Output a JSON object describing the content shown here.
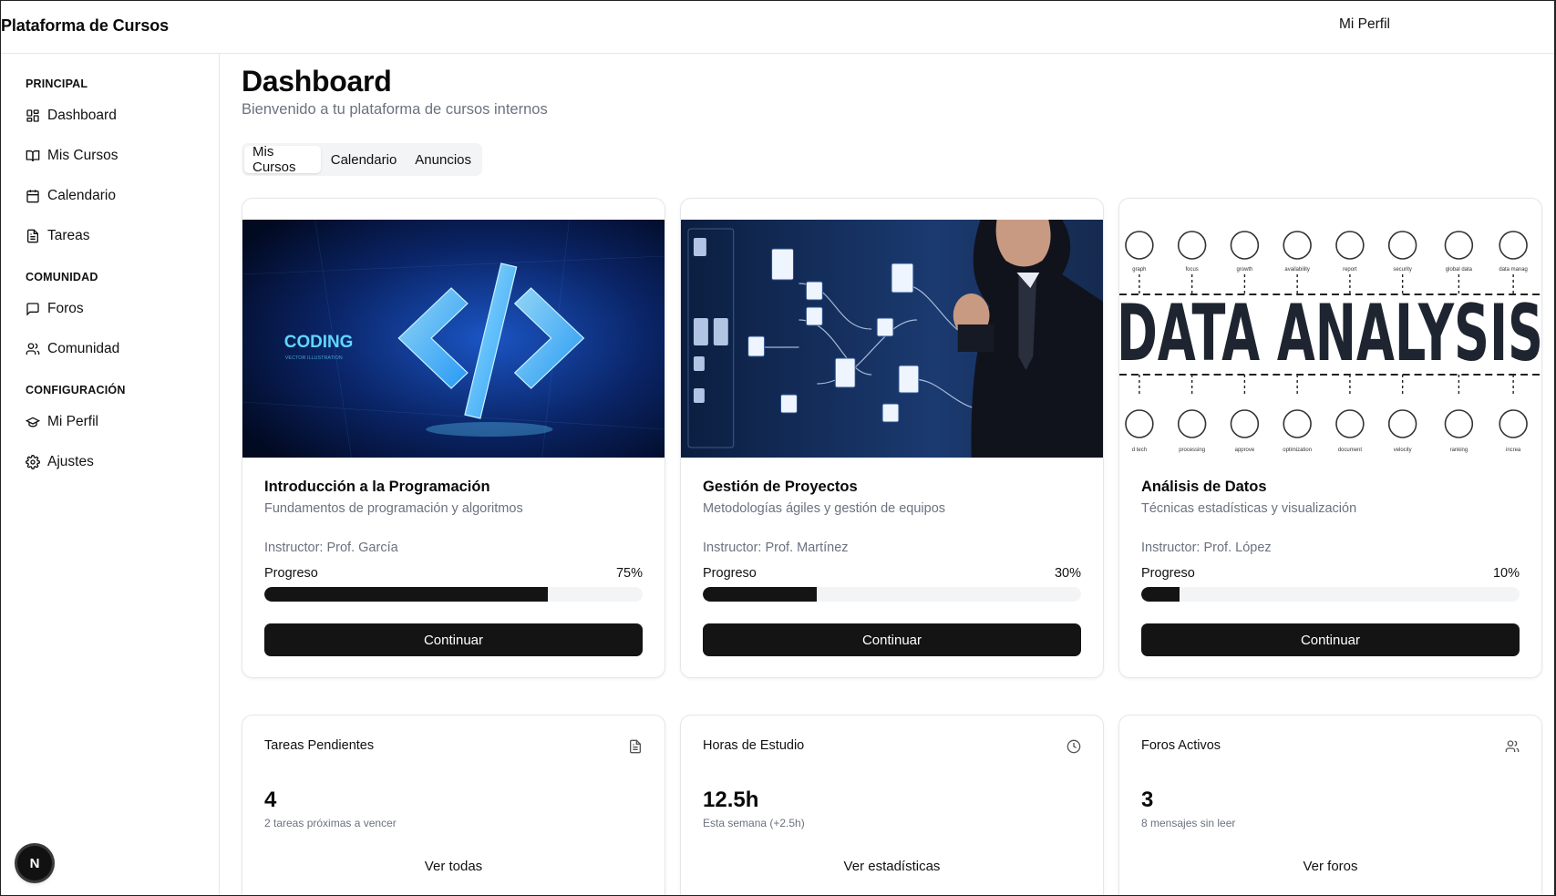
{
  "header": {
    "brand": "Plataforma de Cursos",
    "profile_link": "Mi Perfil"
  },
  "sidebar": {
    "sections": [
      {
        "label": "PRINCIPAL",
        "items": [
          {
            "label": "Dashboard",
            "icon": "dashboard-icon"
          },
          {
            "label": "Mis Cursos",
            "icon": "book-open-icon"
          },
          {
            "label": "Calendario",
            "icon": "calendar-icon"
          },
          {
            "label": "Tareas",
            "icon": "file-text-icon"
          }
        ]
      },
      {
        "label": "COMUNIDAD",
        "items": [
          {
            "label": "Foros",
            "icon": "message-square-icon"
          },
          {
            "label": "Comunidad",
            "icon": "users-icon"
          }
        ]
      },
      {
        "label": "CONFIGURACIÓN",
        "items": [
          {
            "label": "Mi Perfil",
            "icon": "graduation-cap-icon"
          },
          {
            "label": "Ajustes",
            "icon": "settings-icon"
          }
        ]
      }
    ]
  },
  "main": {
    "title": "Dashboard",
    "subtitle": "Bienvenido a tu plataforma de cursos internos",
    "tabs": [
      {
        "label": "Mis Cursos",
        "active": true
      },
      {
        "label": "Calendario",
        "active": false
      },
      {
        "label": "Anuncios",
        "active": false
      }
    ],
    "courses": [
      {
        "title": "Introducción a la Programación",
        "description": "Fundamentos de programación y algoritmos",
        "instructor": "Instructor: Prof. García",
        "progress_label": "Progreso",
        "progress_text": "75%",
        "progress": 0.75,
        "button": "Continuar",
        "image_text": "CODING",
        "image_subtext": "VECTOR ILLUSTRATION"
      },
      {
        "title": "Gestión de Proyectos",
        "description": "Metodologías ágiles y gestión de equipos",
        "instructor": "Instructor: Prof. Martínez",
        "progress_label": "Progreso",
        "progress_text": "30%",
        "progress": 0.3,
        "button": "Continuar"
      },
      {
        "title": "Análisis de Datos",
        "description": "Técnicas estadísticas y visualización",
        "instructor": "Instructor: Prof. López",
        "progress_label": "Progreso",
        "progress_text": "10%",
        "progress": 0.1,
        "button": "Continuar",
        "image_text": "DATA ANALYSIS",
        "image_top_labels": [
          "graph",
          "focus",
          "growth",
          "availability",
          "report",
          "security",
          "global data",
          "data manag"
        ],
        "image_bottom_labels": [
          "d tech",
          "processing",
          "approve",
          "optimization",
          "document",
          "velocity",
          "ranking",
          "increa"
        ]
      }
    ],
    "stats": [
      {
        "title": "Tareas Pendientes",
        "value": "4",
        "note": "2 tareas próximas a vencer",
        "link": "Ver todas",
        "icon": "file-text-icon"
      },
      {
        "title": "Horas de Estudio",
        "value": "12.5h",
        "note": "Esta semana (+2.5h)",
        "link": "Ver estadísticas",
        "icon": "clock-icon"
      },
      {
        "title": "Foros Activos",
        "value": "3",
        "note": "8 mensajes sin leer",
        "link": "Ver foros",
        "icon": "users-icon"
      }
    ]
  },
  "floating_badge": "N"
}
